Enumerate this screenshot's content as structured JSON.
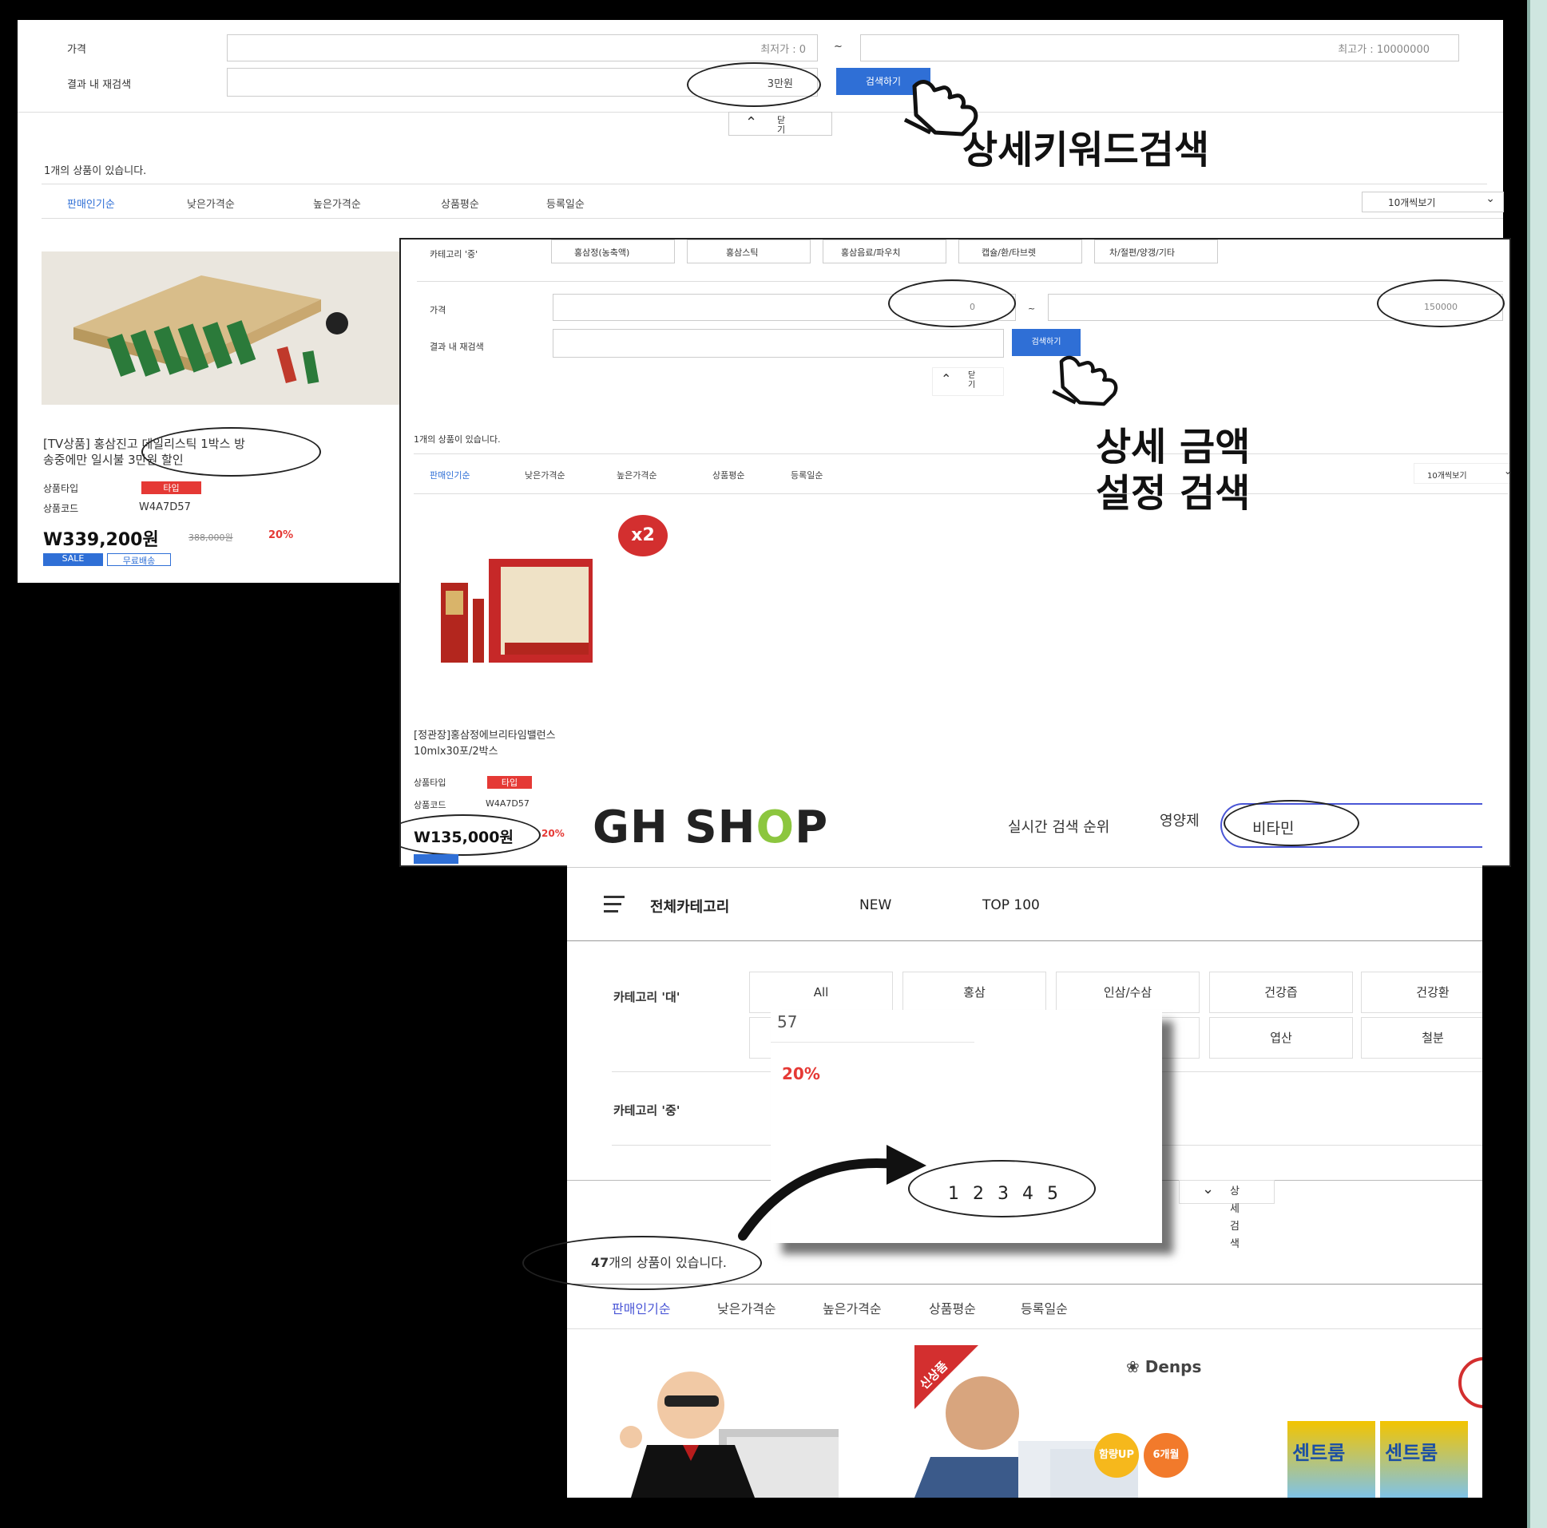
{
  "panel1": {
    "price_label": "가격",
    "min_price_placeholder": "최저가 : 0",
    "tilde": "~",
    "max_price_placeholder": "최고가 : 10000000",
    "result_search_label": "결과 내 재검색",
    "keyword_value": "3만원",
    "search_button": "검색하기",
    "close_label": "닫기",
    "result_count": "1개의 상품이 있습니다.",
    "sort_options": [
      "판매인기순",
      "낮은가격순",
      "높은가격순",
      "상품평순",
      "등록일순"
    ],
    "view_count": "10개씩보기",
    "product": {
      "name_line1": "[TV상품] 홍삼진고 데일리스틱 1박스 방",
      "name_line2": "송중에만 일시불 3만원 할인",
      "type_label": "상품타입",
      "type_badge": "타입",
      "code_label": "상품코드",
      "code_value": "W4A7D57",
      "price": "W339,200원",
      "original_price": "388,000원",
      "discount": "20%",
      "tag_sale": "SALE",
      "tag_free": "무료배송"
    }
  },
  "annotation1": "상세키워드검색",
  "panel2": {
    "category_mid_label": "카테고리 '중'",
    "category_mid_items": [
      "홍삼정(농축액)",
      "홍삼스틱",
      "홍삼음료/파우치",
      "캡슐/환/타브렛",
      "차/절편/양갱/기타"
    ],
    "price_label": "가격",
    "min_price_value": "0",
    "tilde": "~",
    "max_price_value": "150000",
    "result_search_label": "결과 내 재검색",
    "search_button": "검색하기",
    "close_label": "닫기",
    "result_count": "1개의 상품이 있습니다.",
    "sort_options": [
      "판매인기순",
      "낮은가격순",
      "높은가격순",
      "상품평순",
      "등록일순"
    ],
    "view_count": "10개씩보기",
    "badge": "x2",
    "product": {
      "name_line1": "[정관장]홍삼정에브리타임밸런스",
      "name_line2": "10mlx30포/2박스",
      "type_label": "상품타입",
      "type_badge": "타입",
      "code_label": "상품코드",
      "code_value": "W4A7D57",
      "price": "W135,000원",
      "discount": "20%"
    }
  },
  "annotation2_line1": "상세 금액",
  "annotation2_line2": "설정 검색",
  "panel3": {
    "logo_gh": "GH SH",
    "logo_o": "O",
    "logo_p": "P",
    "realtime_search": "실시간 검색 순위",
    "keyword_rank": "영양제",
    "search_value": "비타민",
    "all_categories": "전체카테고리",
    "nav_new": "NEW",
    "nav_top100": "TOP 100",
    "category_big_label": "카테고리 '대'",
    "category_big_items": [
      "All",
      "홍삼",
      "인삼/수삼",
      "건강즙",
      "건강환"
    ],
    "category_big_row2": [
      "엽산",
      "철분"
    ],
    "category_mid_label": "카테고리 '중'",
    "detail_search": [
      "상",
      "세",
      "검",
      "색"
    ],
    "result_count_num": "47",
    "result_count_text": "개의 상품이 있습니다.",
    "sort_options": [
      "판매인기순",
      "낮은가격순",
      "높은가격순",
      "상품평순",
      "등록일순"
    ],
    "brand_denps": "Denps",
    "new_badge": "신상품",
    "bubble1": "함량UP",
    "bubble2": "6개월",
    "centrum": "센트룸"
  },
  "popup": {
    "code_fragment": "57",
    "discount": "20%",
    "pages": [
      "1",
      "2",
      "3",
      "4",
      "5"
    ]
  },
  "colors": {
    "accent_blue": "#2f6fd6",
    "logo_green": "#8cc63f",
    "discount_red": "#e53935",
    "badge_red": "#d32f2f"
  }
}
